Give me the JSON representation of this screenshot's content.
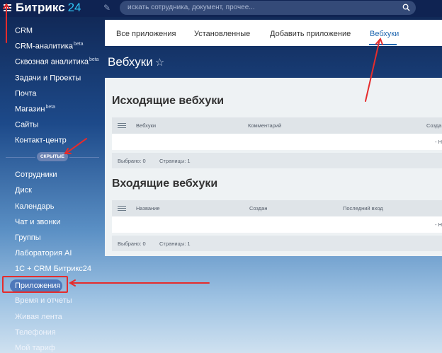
{
  "header": {
    "logo_name": "Битрикс",
    "logo_number": "24",
    "search_placeholder": "искать сотрудника, документ, прочее..."
  },
  "sidebar": {
    "items": [
      {
        "label": "CRM",
        "sup": ""
      },
      {
        "label": "CRM-аналитика",
        "sup": "beta"
      },
      {
        "label": "Сквозная аналитика",
        "sup": "beta"
      },
      {
        "label": "Задачи и Проекты",
        "sup": ""
      },
      {
        "label": "Почта",
        "sup": ""
      },
      {
        "label": "Магазин",
        "sup": "beta"
      },
      {
        "label": "Сайты",
        "sup": ""
      },
      {
        "label": "Контакт-центр",
        "sup": ""
      }
    ],
    "hidden_label": "СКРЫТЫЕ",
    "hidden_items": [
      {
        "label": "Сотрудники"
      },
      {
        "label": "Диск"
      },
      {
        "label": "Календарь"
      },
      {
        "label": "Чат и звонки"
      },
      {
        "label": "Группы"
      },
      {
        "label": "Лаборатория AI"
      },
      {
        "label": "1С + CRM Битрикс24"
      },
      {
        "label": "Приложения"
      },
      {
        "label": "Время и отчеты"
      },
      {
        "label": "Живая лента"
      },
      {
        "label": "Телефония"
      },
      {
        "label": "Мой тариф"
      }
    ]
  },
  "tabs": [
    {
      "label": "Все приложения"
    },
    {
      "label": "Установленные"
    },
    {
      "label": "Добавить приложение"
    },
    {
      "label": "Вебхуки"
    }
  ],
  "page": {
    "title": "Вебхуки",
    "star": "☆"
  },
  "outgoing": {
    "title": "Исходящие вебхуки",
    "columns": [
      "Вебхуки",
      "Комментарий",
      "Созда"
    ],
    "empty": "- Н",
    "selected": "Выбрано: 0",
    "pages": "Страницы: 1"
  },
  "incoming": {
    "title": "Входящие вебхуки",
    "columns": [
      "Название",
      "Создан",
      "Последний вход"
    ],
    "empty": "- Н",
    "selected": "Выбрано: 0",
    "pages": "Страницы: 1"
  },
  "colors": {
    "accent": "#2067b0",
    "header_bg": "#0f2352",
    "annotation_red": "#e52c2c"
  }
}
